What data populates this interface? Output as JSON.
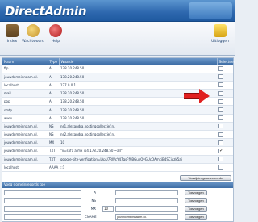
{
  "app": {
    "title": "DirectAdmin"
  },
  "toolbar": {
    "home_label": "Index",
    "password_label": "Wachtwoord",
    "help_label": "Help",
    "logout_label": "Uitloggen"
  },
  "records_table": {
    "headers": [
      "Naam",
      "Type",
      "Waarde",
      "Selecteer"
    ],
    "rows": [
      {
        "name": "ftp",
        "type": "A",
        "value": "178.20.248.50",
        "checked": false
      },
      {
        "name": "jouwdomeinnaam.nl.",
        "type": "A",
        "value": "178.20.248.50",
        "checked": false
      },
      {
        "name": "localhost",
        "type": "A",
        "value": "127.0.0.1",
        "checked": false
      },
      {
        "name": "mail",
        "type": "A",
        "value": "178.20.248.50",
        "checked": false
      },
      {
        "name": "pop",
        "type": "A",
        "value": "178.20.248.50",
        "checked": false
      },
      {
        "name": "smtp",
        "type": "A",
        "value": "178.20.248.50",
        "checked": false
      },
      {
        "name": "www",
        "type": "A",
        "value": "178.20.248.50",
        "checked": false
      },
      {
        "name": "jouwdomeinnaam.nl.",
        "type": "NS",
        "value": "ns1.alexandra.hostingcollectief.nl.",
        "checked": false
      },
      {
        "name": "jouwdomeinnaam.nl.",
        "type": "NS",
        "value": "ns2.alexandra.hostingcollectief.nl.",
        "checked": false
      },
      {
        "name": "jouwdomeinnaam.nl.",
        "type": "MX",
        "value": "10",
        "checked": false
      },
      {
        "name": "jouwdomeinnaam.nl.",
        "type": "TXT",
        "value": "\"v=spf1 a mx ip4:178.20.248.50 ~all\"",
        "checked": true
      },
      {
        "name": "jouwdomeinnaam.nl.",
        "type": "TXT",
        "value": "google-site-verification=IApU7RWcY47gsFf9BGunOvGUcOAmcjB4SCjuzk5aj",
        "checked": false
      },
      {
        "name": "localhost",
        "type": "AAAA",
        "value": "::1",
        "checked": false
      }
    ]
  },
  "delete_button": {
    "label": "Verwijder geselecteerde"
  },
  "add_section": {
    "title": "Voeg domeinrecords toe",
    "rows": [
      {
        "type": "A",
        "value": "",
        "button": "Toevoegen"
      },
      {
        "type": "NS",
        "value": "",
        "button": "Toevoegen"
      },
      {
        "type": "MX",
        "select_value": "10",
        "value": "",
        "button": "Toevoegen"
      },
      {
        "type": "CNAME",
        "value": "jouwdomeinnaam.nl.",
        "button": "Toevoegen"
      }
    ]
  },
  "colors": {
    "header_blue": "#2d67ae",
    "arrow_red": "#e02020"
  }
}
